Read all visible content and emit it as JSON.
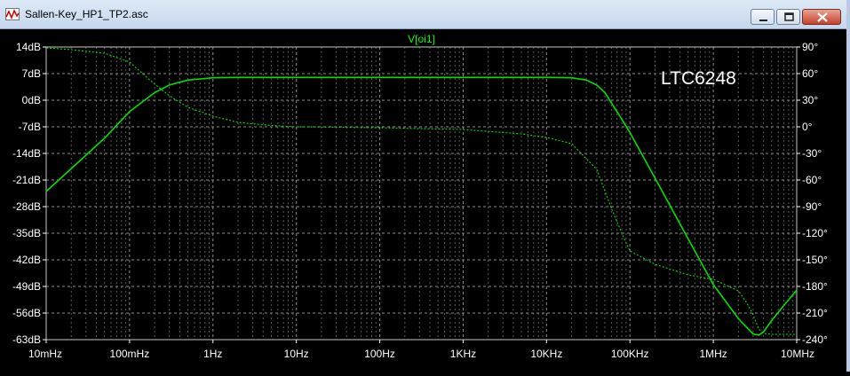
{
  "window": {
    "title": "Sallen-Key_HP1_TP2.asc"
  },
  "plot": {
    "trace_label": "V[oi1]",
    "annotation": "LTC6248",
    "colors": {
      "background": "#000000",
      "trace": "#00e000",
      "grid": "#8c8c8c",
      "axis_text": "#ffffff",
      "trace_label": "#00ff00"
    }
  },
  "chart_data": {
    "type": "line",
    "title": "V[oi1]",
    "xscale": "log",
    "x_ticks": [
      "10mHz",
      "100mHz",
      "1Hz",
      "10Hz",
      "100Hz",
      "1KHz",
      "10KHz",
      "100KHz",
      "1MHz",
      "10MHz"
    ],
    "y_left_ticks": [
      "14dB",
      "7dB",
      "0dB",
      "-7dB",
      "-14dB",
      "-21dB",
      "-28dB",
      "-35dB",
      "-42dB",
      "-49dB",
      "-56dB",
      "-63dB"
    ],
    "y_right_ticks": [
      "90°",
      "60°",
      "30°",
      "0°",
      "-30°",
      "-60°",
      "-90°",
      "-120°",
      "-150°",
      "-180°",
      "-210°",
      "-240°"
    ],
    "ylim_db": [
      -63,
      14
    ],
    "ylim_deg": [
      -240,
      90
    ],
    "grid": true,
    "series": [
      {
        "style": "solid",
        "axis": "left",
        "x": [
          0.01,
          0.02,
          0.05,
          0.1,
          0.2,
          0.3,
          0.5,
          0.7,
          1,
          2,
          5,
          10,
          100,
          1000,
          10000,
          20000,
          30000,
          40000,
          50000,
          70000,
          100000,
          200000,
          500000,
          1000000,
          2000000,
          3000000,
          3500000,
          4000000,
          5000000,
          7000000,
          10000000
        ],
        "y": [
          -24,
          -18,
          -10,
          -3,
          2,
          4,
          5.3,
          5.6,
          5.9,
          6,
          6,
          6,
          6,
          6,
          6,
          5.9,
          5.3,
          4,
          2,
          -3,
          -8.5,
          -20.5,
          -36.5,
          -48.5,
          -57.5,
          -61.5,
          -61.8,
          -61,
          -58,
          -54,
          -50
        ]
      },
      {
        "style": "dashed",
        "axis": "right",
        "x": [
          0.01,
          0.02,
          0.05,
          0.1,
          0.2,
          0.3,
          0.5,
          1,
          2,
          5,
          10,
          100,
          1000,
          5000,
          10000,
          20000,
          40000,
          60000,
          80000,
          100000,
          200000,
          500000,
          1000000,
          2000000,
          2500000,
          3000000,
          3500000,
          4000000,
          5000000,
          10000000
        ],
        "y": [
          89,
          87,
          83,
          73,
          48,
          35,
          22,
          12,
          5,
          1.5,
          0,
          -1,
          -3,
          -8,
          -12,
          -19,
          -48,
          -92,
          -120,
          -140,
          -155,
          -167,
          -172,
          -185,
          -198,
          -212,
          -228,
          -233,
          -234,
          -234
        ]
      }
    ]
  }
}
